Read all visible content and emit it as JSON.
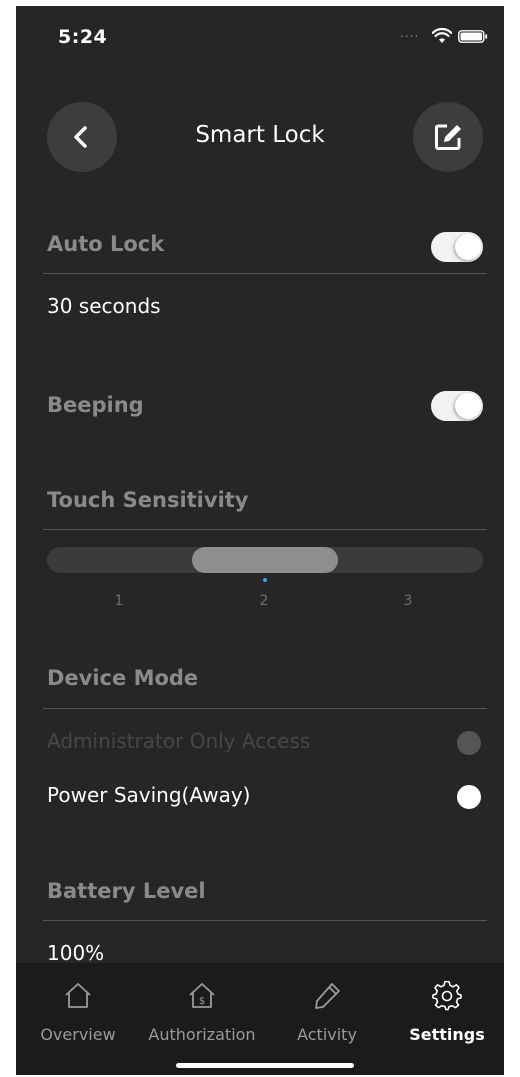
{
  "status_bar": {
    "time": "5:24",
    "signal": "....",
    "wifi_icon": "wifi-icon",
    "battery_icon": "battery-icon"
  },
  "header": {
    "title": "Smart Lock",
    "back_icon": "chevron-left-icon",
    "edit_icon": "edit-icon"
  },
  "auto_lock": {
    "label": "Auto Lock",
    "enabled": true,
    "value": "30 seconds"
  },
  "beeping": {
    "label": "Beeping",
    "enabled": true
  },
  "touch_sensitivity": {
    "label": "Touch Sensitivity",
    "ticks": [
      "1",
      "2",
      "3"
    ],
    "selected": "2"
  },
  "device_mode": {
    "label": "Device Mode",
    "options": [
      {
        "label": "Administrator Only Access",
        "selected": false,
        "disabled": true
      },
      {
        "label": "Power Saving(Away)",
        "selected": true,
        "disabled": false
      }
    ]
  },
  "battery": {
    "label": "Battery Level",
    "value": "100%"
  },
  "tabs": [
    {
      "label": "Overview",
      "icon": "home-icon",
      "active": false
    },
    {
      "label": "Authorization",
      "icon": "home-key-icon",
      "active": false
    },
    {
      "label": "Activity",
      "icon": "pencil-icon",
      "active": false
    },
    {
      "label": "Settings",
      "icon": "gear-icon",
      "active": true
    }
  ],
  "colors": {
    "background": "#262626",
    "tab_bar": "#1b1b1b",
    "accent_dot": "#3ca7e0",
    "toggle_on": "#f2f2f2"
  }
}
